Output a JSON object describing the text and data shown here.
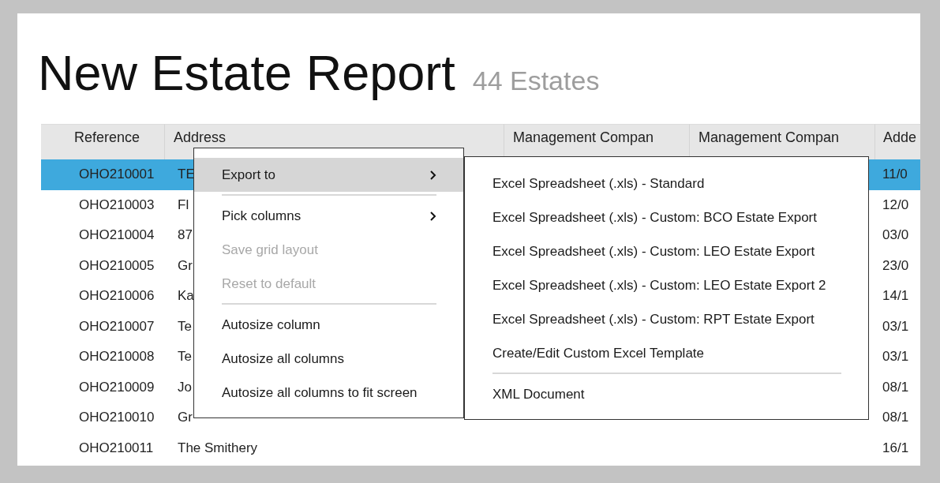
{
  "title": "New Estate Report",
  "subtitle": "44 Estates",
  "table": {
    "columns": [
      "Reference",
      "Address",
      "Management Compan",
      "Management Compan",
      "Adde"
    ],
    "rows": [
      {
        "cells": [
          "OHO210001",
          "TE",
          "",
          "",
          "11/0"
        ],
        "selected": true
      },
      {
        "cells": [
          "OHO210003",
          "Fl",
          "",
          "",
          "12/0"
        ],
        "selected": false
      },
      {
        "cells": [
          "OHO210004",
          "87",
          "",
          "",
          "03/0"
        ],
        "selected": false
      },
      {
        "cells": [
          "OHO210005",
          "Gr",
          "",
          "",
          "23/0"
        ],
        "selected": false
      },
      {
        "cells": [
          "OHO210006",
          "Ka",
          "",
          "",
          "14/1"
        ],
        "selected": false
      },
      {
        "cells": [
          "OHO210007",
          "Te",
          "",
          "",
          "03/1"
        ],
        "selected": false
      },
      {
        "cells": [
          "OHO210008",
          "Te",
          "",
          "",
          "03/1"
        ],
        "selected": false
      },
      {
        "cells": [
          "OHO210009",
          "Jo",
          "",
          "",
          "08/1"
        ],
        "selected": false
      },
      {
        "cells": [
          "OHO210010",
          "Gr",
          "",
          "",
          "08/1"
        ],
        "selected": false
      },
      {
        "cells": [
          "OHO210011",
          "The Smithery",
          "",
          "",
          "16/1"
        ],
        "selected": false
      }
    ]
  },
  "context_menu": {
    "items": [
      {
        "kind": "submenu",
        "label": "Export to",
        "selected": true,
        "disabled": false
      },
      {
        "kind": "separator"
      },
      {
        "kind": "submenu",
        "label": "Pick columns",
        "selected": false,
        "disabled": false
      },
      {
        "kind": "item",
        "label": "Save grid layout",
        "selected": false,
        "disabled": true
      },
      {
        "kind": "item",
        "label": "Reset to default",
        "selected": false,
        "disabled": true
      },
      {
        "kind": "separator"
      },
      {
        "kind": "item",
        "label": "Autosize column",
        "selected": false,
        "disabled": false
      },
      {
        "kind": "item",
        "label": "Autosize all columns",
        "selected": false,
        "disabled": false
      },
      {
        "kind": "item",
        "label": "Autosize all columns to fit screen",
        "selected": false,
        "disabled": false
      }
    ]
  },
  "submenu": {
    "items": [
      {
        "kind": "item",
        "label": "Excel Spreadsheet (.xls) - Standard"
      },
      {
        "kind": "item",
        "label": "Excel Spreadsheet (.xls) - Custom: BCO Estate Export"
      },
      {
        "kind": "item",
        "label": "Excel Spreadsheet (.xls) - Custom: LEO Estate Export"
      },
      {
        "kind": "item",
        "label": "Excel Spreadsheet (.xls) - Custom: LEO Estate Export 2"
      },
      {
        "kind": "item",
        "label": "Excel Spreadsheet (.xls) - Custom: RPT Estate Export"
      },
      {
        "kind": "item",
        "label": "Create/Edit Custom Excel Template"
      },
      {
        "kind": "separator"
      },
      {
        "kind": "item",
        "label": "XML Document"
      }
    ]
  }
}
